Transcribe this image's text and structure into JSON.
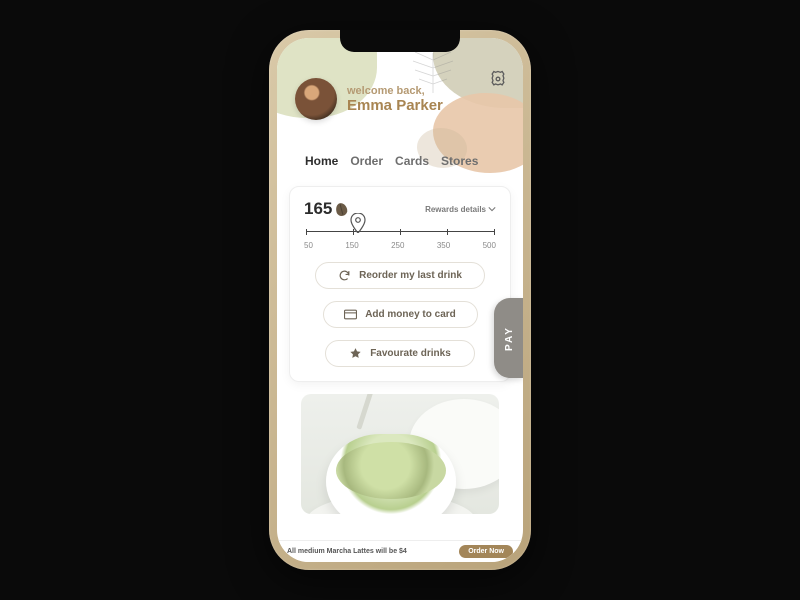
{
  "header": {
    "welcome_small": "welcome back,",
    "user_name": "Emma Parker"
  },
  "tabs": [
    "Home",
    "Order",
    "Cards",
    "Stores"
  ],
  "active_tab_index": 0,
  "rewards": {
    "points": "165",
    "details_label": "Rewards details",
    "scale": [
      "50",
      "150",
      "250",
      "350",
      "500"
    ],
    "marker_fraction": 0.28
  },
  "actions": {
    "reorder": "Reorder my last drink",
    "add_money": "Add money to card",
    "favourite": "Favourate drinks"
  },
  "pay_label": "PAY",
  "promo": {
    "text": "All medium Marcha Lattes will be $4",
    "cta": "Order Now"
  }
}
